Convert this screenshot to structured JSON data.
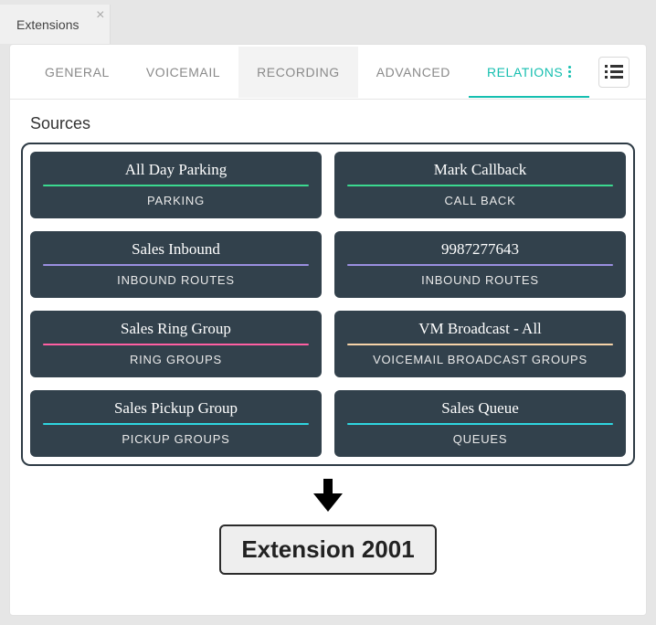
{
  "window": {
    "tabs": [
      {
        "label": "Extensions"
      }
    ]
  },
  "inner_tabs": {
    "general": "GENERAL",
    "voicemail": "VOICEMAIL",
    "recording": "RECORDING",
    "advanced": "ADVANCED",
    "relations": "RELATIONS"
  },
  "section_title": "Sources",
  "sources": [
    {
      "title": "All Day Parking",
      "type": "PARKING",
      "color": "#3bd98f"
    },
    {
      "title": "Mark Callback",
      "type": "CALL BACK",
      "color": "#3bd98f"
    },
    {
      "title": "Sales Inbound",
      "type": "INBOUND ROUTES",
      "color": "#9a8fe0"
    },
    {
      "title": "9987277643",
      "type": "INBOUND ROUTES",
      "color": "#9a8fe0"
    },
    {
      "title": "Sales Ring Group",
      "type": "RING GROUPS",
      "color": "#ff5fa2"
    },
    {
      "title": "VM Broadcast - All",
      "type": "VOICEMAIL BROADCAST GROUPS",
      "color": "#f6d3a8"
    },
    {
      "title": "Sales Pickup Group",
      "type": "PICKUP GROUPS",
      "color": "#2fd6e0"
    },
    {
      "title": "Sales Queue",
      "type": "QUEUES",
      "color": "#2fd6e0"
    }
  ],
  "target": "Extension 2001"
}
